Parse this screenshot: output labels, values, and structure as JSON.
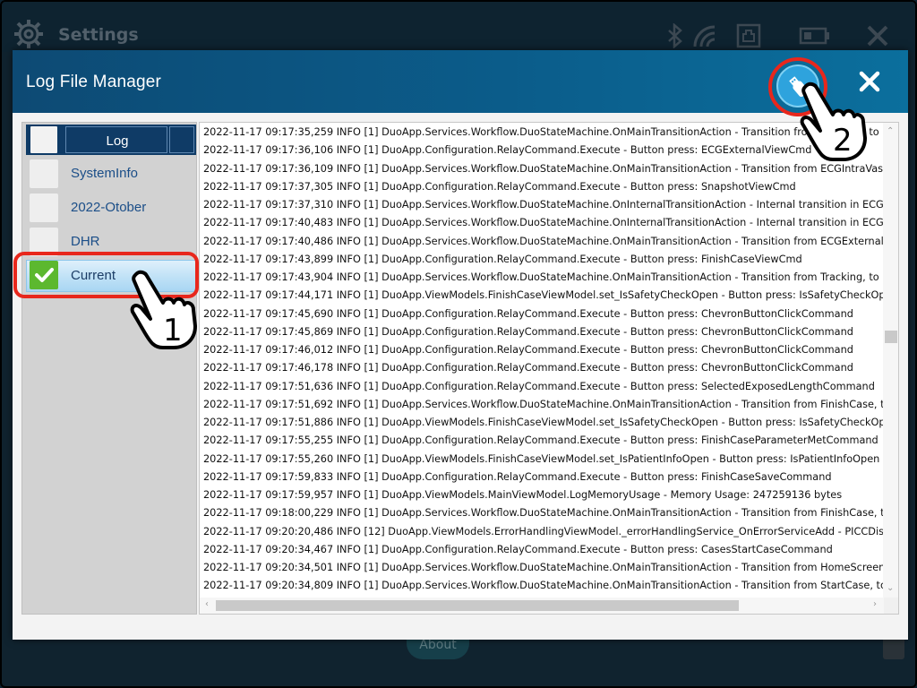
{
  "background": {
    "title": "Settings",
    "about_label": "About"
  },
  "dialog": {
    "title": "Log File Manager",
    "usb_icon": "usb-drive-icon",
    "close_icon": "close-icon"
  },
  "sidebar": {
    "items": [
      {
        "label": "Log",
        "checked": false
      },
      {
        "label": "SystemInfo",
        "checked": false
      },
      {
        "label": "2022-Otober",
        "checked": false
      },
      {
        "label": "DHR",
        "checked": false
      },
      {
        "label": "Current",
        "checked": true
      }
    ]
  },
  "annotations": {
    "step1": "1",
    "step2": "2"
  },
  "log": {
    "lines": [
      "2022-11-17 09:17:35,259 INFO [1] DuoApp.Services.Workflow.DuoStateMachine.OnMainTransitionAction - Transition from Tracking, to ECGI",
      "2022-11-17 09:17:36,106 INFO [1] DuoApp.Configuration.RelayCommand.Execute - Button press: ECGExternalViewCmd",
      "2022-11-17 09:17:36,109 INFO [1] DuoApp.Services.Workflow.DuoStateMachine.OnMainTransitionAction - Transition from ECGIntraVascular",
      "2022-11-17 09:17:37,305 INFO [1] DuoApp.Configuration.RelayCommand.Execute - Button press: SnapshotViewCmd",
      "2022-11-17 09:17:37,310 INFO [1] DuoApp.Services.Workflow.DuoStateMachine.OnInternalTransitionAction - Internal transition in ECGExte",
      "2022-11-17 09:17:40,483 INFO [1] DuoApp.Services.Workflow.DuoStateMachine.OnInternalTransitionAction - Internal transition in ECGExte",
      "2022-11-17 09:17:40,486 INFO [1] DuoApp.Services.Workflow.DuoStateMachine.OnMainTransitionAction - Transition from ECGExternal, to T",
      "2022-11-17 09:17:43,899 INFO [1] DuoApp.Configuration.RelayCommand.Execute - Button press: FinishCaseViewCmd",
      "2022-11-17 09:17:43,904 INFO [1] DuoApp.Services.Workflow.DuoStateMachine.OnMainTransitionAction - Transition from Tracking, to Finis",
      "2022-11-17 09:17:44,171 INFO [1] DuoApp.ViewModels.FinishCaseViewModel.set_IsSafetyCheckOpen - Button press: IsSafetyCheckOpen",
      "2022-11-17 09:17:45,690 INFO [1] DuoApp.Configuration.RelayCommand.Execute - Button press: ChevronButtonClickCommand",
      "2022-11-17 09:17:45,869 INFO [1] DuoApp.Configuration.RelayCommand.Execute - Button press: ChevronButtonClickCommand",
      "2022-11-17 09:17:46,012 INFO [1] DuoApp.Configuration.RelayCommand.Execute - Button press: ChevronButtonClickCommand",
      "2022-11-17 09:17:46,178 INFO [1] DuoApp.Configuration.RelayCommand.Execute - Button press: ChevronButtonClickCommand",
      "2022-11-17 09:17:51,636 INFO [1] DuoApp.Configuration.RelayCommand.Execute - Button press: SelectedExposedLengthCommand",
      "2022-11-17 09:17:51,692 INFO [1] DuoApp.Services.Workflow.DuoStateMachine.OnMainTransitionAction - Transition from FinishCase, to Fir",
      "2022-11-17 09:17:51,886 INFO [1] DuoApp.ViewModels.FinishCaseViewModel.set_IsSafetyCheckOpen - Button press: IsSafetyCheckOpen",
      "2022-11-17 09:17:55,255 INFO [1] DuoApp.Configuration.RelayCommand.Execute - Button press: FinishCaseParameterMetCommand",
      "2022-11-17 09:17:55,260 INFO [1] DuoApp.ViewModels.FinishCaseViewModel.set_IsPatientInfoOpen - Button press: IsPatientInfoOpen",
      "2022-11-17 09:17:59,833 INFO [1] DuoApp.Configuration.RelayCommand.Execute - Button press: FinishCaseSaveCommand",
      "2022-11-17 09:17:59,957 INFO [1] DuoApp.ViewModels.MainViewModel.LogMemoryUsage - Memory Usage: 247259136 bytes",
      "2022-11-17 09:18:00,229 INFO [1] DuoApp.Services.Workflow.DuoStateMachine.OnMainTransitionAction - Transition from FinishCase, to Ho",
      "2022-11-17 09:20:20,486 INFO [12] DuoApp.ViewModels.ErrorHandlingViewModel._errorHandlingService_OnErrorServiceAdd - PICCDisconi",
      "2022-11-17 09:20:34,467 INFO [1] DuoApp.Configuration.RelayCommand.Execute - Button press: CasesStartCaseCommand",
      "2022-11-17 09:20:34,501 INFO [1] DuoApp.Services.Workflow.DuoStateMachine.OnMainTransitionAction - Transition from HomeScreen, to S",
      "2022-11-17 09:20:34,809 INFO [1] DuoApp.Services.Workflow.DuoStateMachine.OnMainTransitionAction - Transition from StartCase, to Pat"
    ]
  },
  "colors": {
    "header": "#0b5c8a",
    "highlight_ring": "#e8271c",
    "check_green": "#5cb82f",
    "sidebar_bg": "#d2d2d2"
  }
}
